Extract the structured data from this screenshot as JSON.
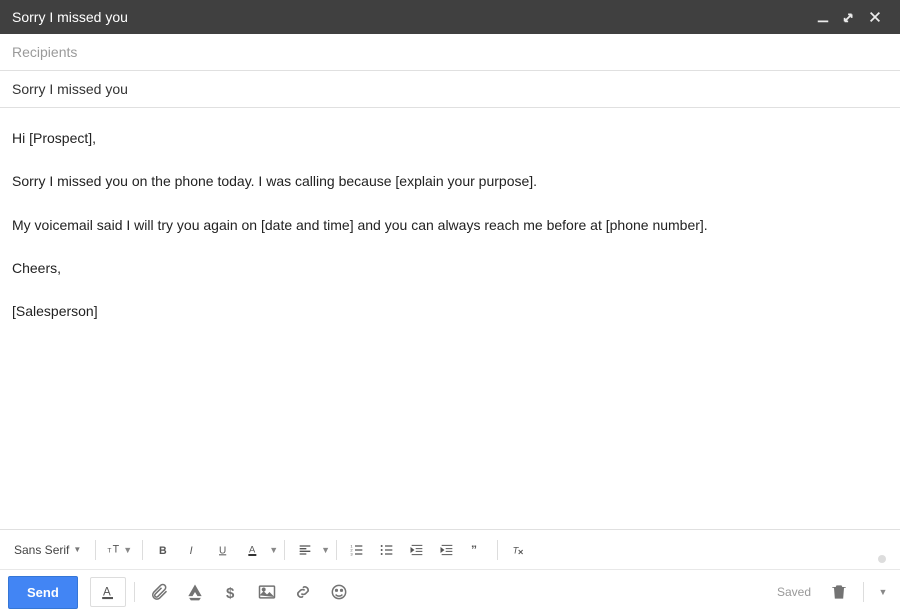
{
  "window": {
    "title": "Sorry I missed you"
  },
  "fields": {
    "recipients_placeholder": "Recipients",
    "subject": "Sorry I missed you"
  },
  "body": {
    "p1": "Hi [Prospect],",
    "p2": "Sorry I missed you on the phone today. I was calling because [explain your purpose].",
    "p3": "My voicemail said I will try you again on [date and time] and you can always reach me before at [phone number].",
    "p4": "Cheers,",
    "p5": "[Salesperson]"
  },
  "format_toolbar": {
    "font": "Sans Serif"
  },
  "bottom": {
    "send": "Send",
    "saved": "Saved"
  }
}
